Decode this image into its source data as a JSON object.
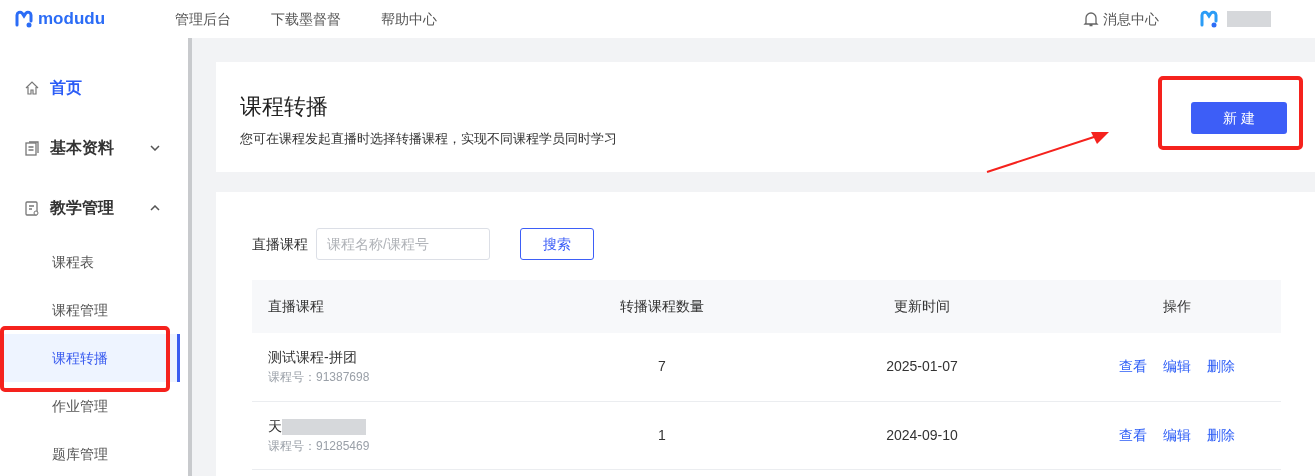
{
  "topbar": {
    "logo": "modudu",
    "nav": [
      "管理后台",
      "下载墨督督",
      "帮助中心"
    ],
    "notifications": "消息中心"
  },
  "sidebar": {
    "items": [
      {
        "label": "首页",
        "kind": "home",
        "selected": true
      },
      {
        "label": "基本资料",
        "kind": "doc",
        "expanded": false,
        "selected": false
      },
      {
        "label": "教学管理",
        "kind": "teach",
        "expanded": true,
        "selected": false,
        "children": [
          {
            "label": "课程表",
            "selected": false
          },
          {
            "label": "课程管理",
            "selected": false
          },
          {
            "label": "课程转播",
            "selected": true
          },
          {
            "label": "作业管理",
            "selected": false
          },
          {
            "label": "题库管理",
            "selected": false
          }
        ]
      }
    ]
  },
  "header": {
    "title": "课程转播",
    "subtitle": "您可在课程发起直播时选择转播课程，实现不同课程学员同时学习",
    "new_button": "新 建"
  },
  "filter": {
    "label": "直播课程",
    "placeholder": "课程名称/课程号",
    "search_button": "搜索"
  },
  "table": {
    "columns": [
      "直播课程",
      "转播课程数量",
      "更新时间",
      "操作"
    ],
    "rows": [
      {
        "name": "测试课程-拼团",
        "code": "课程号：91387698",
        "redacted": false,
        "count": "7",
        "updated": "2025-01-07",
        "actions": [
          "查看",
          "编辑",
          "删除"
        ]
      },
      {
        "name": "天",
        "code": "课程号：91285469",
        "redacted": true,
        "count": "1",
        "updated": "2024-09-10",
        "actions": [
          "查看",
          "编辑",
          "删除"
        ]
      }
    ]
  }
}
